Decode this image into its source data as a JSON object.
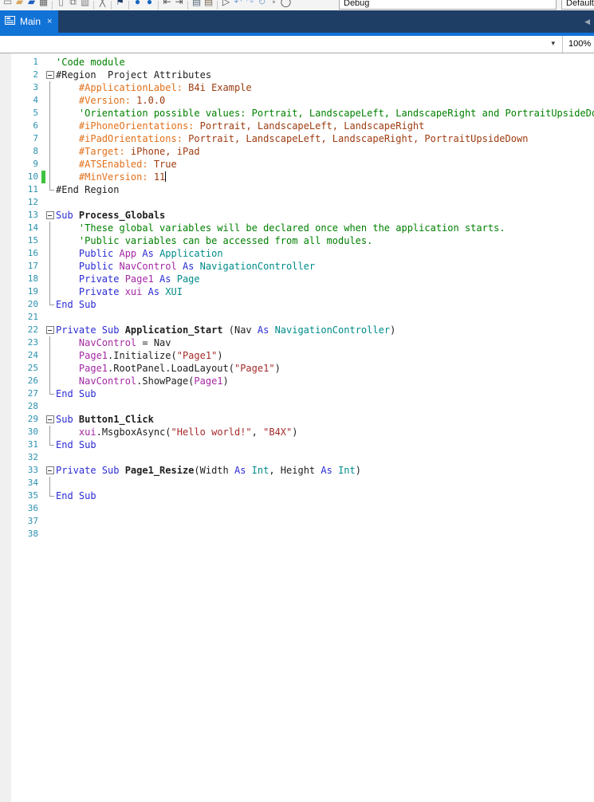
{
  "toolbar": {
    "debug_combo_value": "Debug",
    "build_combo_value": "Default",
    "icons": [
      {
        "name": "new-window-icon",
        "glyph": "▭",
        "color": "#777777"
      },
      {
        "name": "open-folder-icon",
        "glyph": "▰",
        "color": "#d8a75b"
      },
      {
        "name": "save-icon",
        "glyph": "▰",
        "color": "#1e5fc0"
      },
      {
        "name": "save-all-icon",
        "glyph": "▦",
        "color": "#666666"
      },
      {
        "name": "separator"
      },
      {
        "name": "export-project-icon",
        "glyph": "▯",
        "color": "#777777"
      },
      {
        "name": "modules-icon",
        "glyph": "⧉",
        "color": "#777777"
      },
      {
        "name": "designer-icon",
        "glyph": "▥",
        "color": "#777777"
      },
      {
        "name": "separator"
      },
      {
        "name": "cut-icon",
        "glyph": "╳",
        "color": "#666666"
      },
      {
        "name": "separator"
      },
      {
        "name": "bookmark-icon",
        "glyph": "⚑",
        "color": "#1f3864"
      },
      {
        "name": "separator"
      },
      {
        "name": "navigate-back-icon",
        "glyph": "●",
        "color": "#1565c0"
      },
      {
        "name": "navigate-forward-icon",
        "glyph": "●",
        "color": "#1565c0"
      },
      {
        "name": "separator"
      },
      {
        "name": "outdent-icon",
        "glyph": "⇤",
        "color": "#555555"
      },
      {
        "name": "indent-icon",
        "glyph": "⇥",
        "color": "#555555"
      },
      {
        "name": "separator"
      },
      {
        "name": "comment-icon",
        "glyph": "▤",
        "color": "#556677"
      },
      {
        "name": "uncomment-icon",
        "glyph": "▤",
        "color": "#776655"
      },
      {
        "name": "separator"
      },
      {
        "name": "run-icon",
        "glyph": "▷",
        "color": "#444444"
      },
      {
        "name": "undo-icon",
        "glyph": "↶",
        "color": "#7fa8d8"
      },
      {
        "name": "redo-icon",
        "glyph": "↷",
        "color": "#afc8e8"
      },
      {
        "name": "refresh-icon",
        "glyph": "↻",
        "color": "#8fb0d0"
      },
      {
        "name": "pause-icon",
        "glyph": "▪",
        "color": "#aaaaaa"
      },
      {
        "name": "rebuild-icon",
        "glyph": "◯",
        "color": "#333333"
      }
    ]
  },
  "tab_bar": {
    "tabs": [
      {
        "label": "Main",
        "close_glyph": "×",
        "active": true
      }
    ],
    "scroll_left_glyph": "◀"
  },
  "nav_row": {
    "dropdown_glyph": "▾",
    "zoom_level": "100%"
  },
  "editor": {
    "accent_colors": {
      "tab_blue": "#1273d7",
      "tabstrip_navy": "#1f3e66",
      "line_number": "#2b91af",
      "comment": "#008000",
      "keyword": "#2b2bd5",
      "type": "#008b8b",
      "identifier": "#a428a4",
      "string": "#a52a2a",
      "attribute_key": "#e2701a",
      "attribute_value": "#9c3b10",
      "changed_line_bar": "#3fc23f"
    },
    "lines": [
      {
        "n": 1,
        "fold": "",
        "chg": false,
        "caret": false,
        "seg": [
          [
            "cm",
            "'Code module"
          ]
        ]
      },
      {
        "n": 2,
        "fold": "start",
        "chg": false,
        "caret": false,
        "seg": [
          [
            "pl",
            "#Region  Project Attributes"
          ]
        ]
      },
      {
        "n": 3,
        "fold": "mid",
        "chg": false,
        "caret": false,
        "seg": [
          [
            "at",
            "    #ApplicationLabel:"
          ],
          [
            "av",
            " B4i Example"
          ]
        ]
      },
      {
        "n": 4,
        "fold": "mid",
        "chg": false,
        "caret": false,
        "seg": [
          [
            "at",
            "    #Version:"
          ],
          [
            "av",
            " 1.0.0"
          ]
        ]
      },
      {
        "n": 5,
        "fold": "mid",
        "chg": false,
        "caret": false,
        "seg": [
          [
            "cm",
            "    'Orientation possible values: Portrait, LandscapeLeft, LandscapeRight and PortraitUpsideDown"
          ]
        ]
      },
      {
        "n": 6,
        "fold": "mid",
        "chg": false,
        "caret": false,
        "seg": [
          [
            "at",
            "    #iPhoneOrientations:"
          ],
          [
            "av",
            " Portrait, LandscapeLeft, LandscapeRight"
          ]
        ]
      },
      {
        "n": 7,
        "fold": "mid",
        "chg": false,
        "caret": false,
        "seg": [
          [
            "at",
            "    #iPadOrientations:"
          ],
          [
            "av",
            " Portrait, LandscapeLeft, LandscapeRight, PortraitUpsideDown"
          ]
        ]
      },
      {
        "n": 8,
        "fold": "mid",
        "chg": false,
        "caret": false,
        "seg": [
          [
            "at",
            "    #Target:"
          ],
          [
            "av",
            " iPhone, iPad"
          ]
        ]
      },
      {
        "n": 9,
        "fold": "mid",
        "chg": false,
        "caret": false,
        "seg": [
          [
            "at",
            "    #ATSEnabled:"
          ],
          [
            "av",
            " True"
          ]
        ]
      },
      {
        "n": 10,
        "fold": "mid",
        "chg": true,
        "caret": true,
        "seg": [
          [
            "at",
            "    #MinVersion:"
          ],
          [
            "av",
            " 11"
          ]
        ]
      },
      {
        "n": 11,
        "fold": "end",
        "chg": false,
        "caret": false,
        "seg": [
          [
            "pl",
            "#End Region"
          ]
        ]
      },
      {
        "n": 12,
        "fold": "",
        "chg": false,
        "caret": false,
        "seg": []
      },
      {
        "n": 13,
        "fold": "start",
        "chg": false,
        "caret": false,
        "seg": [
          [
            "kw",
            "Sub "
          ],
          [
            "sb",
            "Process_Globals"
          ]
        ]
      },
      {
        "n": 14,
        "fold": "mid",
        "chg": false,
        "caret": false,
        "seg": [
          [
            "cm",
            "    'These global variables will be declared once when the application starts."
          ]
        ]
      },
      {
        "n": 15,
        "fold": "mid",
        "chg": false,
        "caret": false,
        "seg": [
          [
            "cm",
            "    'Public variables can be accessed from all modules."
          ]
        ]
      },
      {
        "n": 16,
        "fold": "mid",
        "chg": false,
        "caret": false,
        "seg": [
          [
            "kw",
            "    Public "
          ],
          [
            "id",
            "App"
          ],
          [
            "kw",
            " As "
          ],
          [
            "ty",
            "Application"
          ]
        ]
      },
      {
        "n": 17,
        "fold": "mid",
        "chg": false,
        "caret": false,
        "seg": [
          [
            "kw",
            "    Public "
          ],
          [
            "id",
            "NavControl"
          ],
          [
            "kw",
            " As "
          ],
          [
            "ty",
            "NavigationController"
          ]
        ]
      },
      {
        "n": 18,
        "fold": "mid",
        "chg": false,
        "caret": false,
        "seg": [
          [
            "kw",
            "    Private "
          ],
          [
            "id",
            "Page1"
          ],
          [
            "kw",
            " As "
          ],
          [
            "ty",
            "Page"
          ]
        ]
      },
      {
        "n": 19,
        "fold": "mid",
        "chg": false,
        "caret": false,
        "seg": [
          [
            "kw",
            "    Private "
          ],
          [
            "id",
            "xui"
          ],
          [
            "kw",
            " As "
          ],
          [
            "ty",
            "XUI"
          ]
        ]
      },
      {
        "n": 20,
        "fold": "end",
        "chg": false,
        "caret": false,
        "seg": [
          [
            "kw",
            "End Sub"
          ]
        ]
      },
      {
        "n": 21,
        "fold": "",
        "chg": false,
        "caret": false,
        "seg": []
      },
      {
        "n": 22,
        "fold": "start",
        "chg": false,
        "caret": false,
        "seg": [
          [
            "kw",
            "Private Sub "
          ],
          [
            "sb",
            "Application_Start"
          ],
          [
            "pl",
            " (Nav"
          ],
          [
            "kw",
            " As "
          ],
          [
            "ty",
            "NavigationController"
          ],
          [
            "pl",
            ")"
          ]
        ]
      },
      {
        "n": 23,
        "fold": "mid",
        "chg": false,
        "caret": false,
        "seg": [
          [
            "pl",
            "    "
          ],
          [
            "id",
            "NavControl"
          ],
          [
            "pl",
            " = Nav"
          ]
        ]
      },
      {
        "n": 24,
        "fold": "mid",
        "chg": false,
        "caret": false,
        "seg": [
          [
            "pl",
            "    "
          ],
          [
            "id",
            "Page1"
          ],
          [
            "pl",
            ".Initialize("
          ],
          [
            "st",
            "\"Page1\""
          ],
          [
            "pl",
            ")"
          ]
        ]
      },
      {
        "n": 25,
        "fold": "mid",
        "chg": false,
        "caret": false,
        "seg": [
          [
            "pl",
            "    "
          ],
          [
            "id",
            "Page1"
          ],
          [
            "pl",
            ".RootPanel.LoadLayout("
          ],
          [
            "st",
            "\"Page1\""
          ],
          [
            "pl",
            ")"
          ]
        ]
      },
      {
        "n": 26,
        "fold": "mid",
        "chg": false,
        "caret": false,
        "seg": [
          [
            "pl",
            "    "
          ],
          [
            "id",
            "NavControl"
          ],
          [
            "pl",
            ".ShowPage("
          ],
          [
            "id",
            "Page1"
          ],
          [
            "pl",
            ")"
          ]
        ]
      },
      {
        "n": 27,
        "fold": "end",
        "chg": false,
        "caret": false,
        "seg": [
          [
            "kw",
            "End Sub"
          ]
        ]
      },
      {
        "n": 28,
        "fold": "",
        "chg": false,
        "caret": false,
        "seg": []
      },
      {
        "n": 29,
        "fold": "start",
        "chg": false,
        "caret": false,
        "seg": [
          [
            "kw",
            "Sub "
          ],
          [
            "sb",
            "Button1_Click"
          ]
        ]
      },
      {
        "n": 30,
        "fold": "mid",
        "chg": false,
        "caret": false,
        "seg": [
          [
            "pl",
            "    "
          ],
          [
            "id",
            "xui"
          ],
          [
            "pl",
            ".MsgboxAsync("
          ],
          [
            "st",
            "\"Hello world!\""
          ],
          [
            "pl",
            ", "
          ],
          [
            "st",
            "\"B4X\""
          ],
          [
            "pl",
            ")"
          ]
        ]
      },
      {
        "n": 31,
        "fold": "end",
        "chg": false,
        "caret": false,
        "seg": [
          [
            "kw",
            "End Sub"
          ]
        ]
      },
      {
        "n": 32,
        "fold": "",
        "chg": false,
        "caret": false,
        "seg": []
      },
      {
        "n": 33,
        "fold": "start",
        "chg": false,
        "caret": false,
        "seg": [
          [
            "kw",
            "Private Sub "
          ],
          [
            "sb",
            "Page1_Resize"
          ],
          [
            "pl",
            "(Width"
          ],
          [
            "kw",
            " As "
          ],
          [
            "ty",
            "Int"
          ],
          [
            "pl",
            ", Height"
          ],
          [
            "kw",
            " As "
          ],
          [
            "ty",
            "Int"
          ],
          [
            "pl",
            ")"
          ]
        ]
      },
      {
        "n": 34,
        "fold": "mid",
        "chg": false,
        "caret": false,
        "seg": []
      },
      {
        "n": 35,
        "fold": "end",
        "chg": false,
        "caret": false,
        "seg": [
          [
            "kw",
            "End Sub"
          ]
        ]
      },
      {
        "n": 36,
        "fold": "",
        "chg": false,
        "caret": false,
        "seg": []
      },
      {
        "n": 37,
        "fold": "",
        "chg": false,
        "caret": false,
        "seg": []
      },
      {
        "n": 38,
        "fold": "",
        "chg": false,
        "caret": false,
        "seg": []
      }
    ]
  }
}
